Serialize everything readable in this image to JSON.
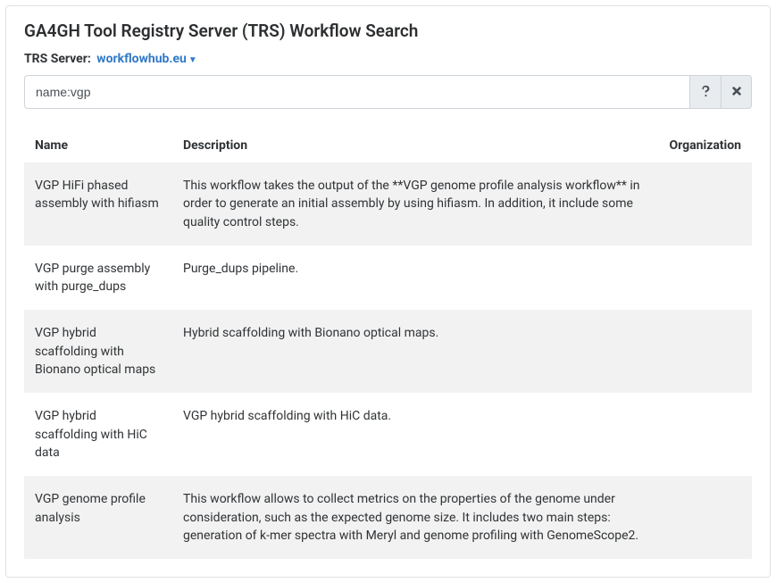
{
  "header": {
    "title": "GA4GH Tool Registry Server (TRS) Workflow Search",
    "server_label": "TRS Server:",
    "server_value": "workflowhub.eu"
  },
  "search": {
    "value": "name:vgp"
  },
  "table": {
    "headers": [
      "Name",
      "Description",
      "Organization"
    ],
    "rows": [
      {
        "name": "VGP HiFi phased assembly with hifiasm",
        "description": "This workflow takes the output of the **VGP genome profile analysis workflow** in order to generate an initial assembly by using hifiasm. In addition, it include some quality control steps.",
        "organization": ""
      },
      {
        "name": "VGP purge assembly with purge_dups",
        "description": "Purge_dups pipeline.",
        "organization": ""
      },
      {
        "name": "VGP hybrid scaffolding with Bionano optical maps",
        "description": "Hybrid scaffolding with Bionano optical maps.",
        "organization": ""
      },
      {
        "name": "VGP hybrid scaffolding with HiC data",
        "description": "VGP hybrid scaffolding with HiC data.",
        "organization": ""
      },
      {
        "name": "VGP genome profile analysis",
        "description": "This workflow allows to collect metrics on the properties of the genome under consideration, such as the expected genome size. It includes two main steps: generation of k-mer spectra with Meryl and genome profiling with GenomeScope2.",
        "organization": ""
      }
    ]
  }
}
